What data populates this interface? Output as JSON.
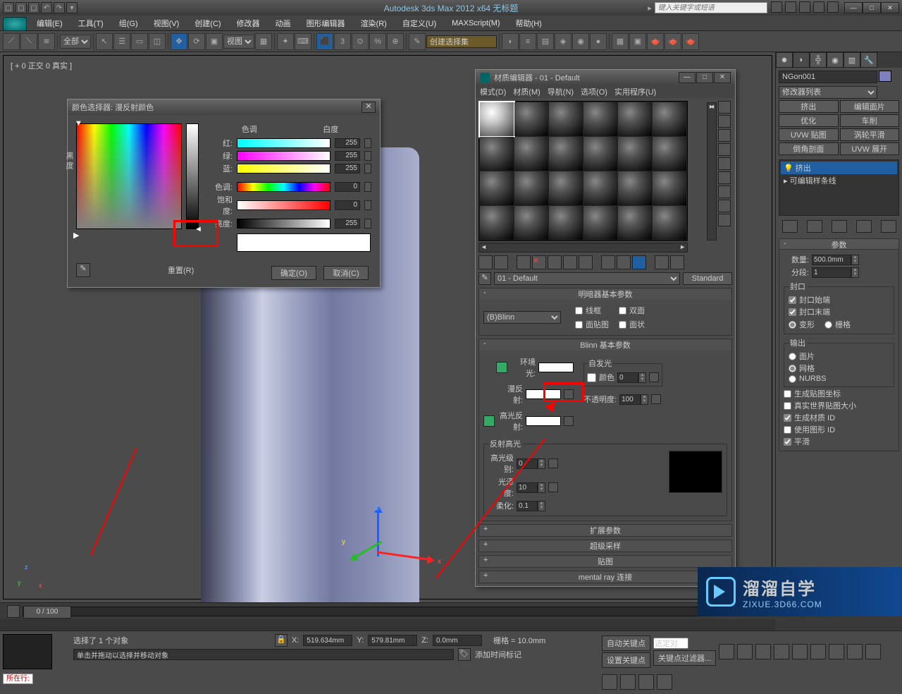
{
  "title": "Autodesk 3ds Max 2012 x64   无标题",
  "searchPlaceholder": "键入关键字或短语",
  "menubar": [
    "编辑(E)",
    "工具(T)",
    "组(G)",
    "视图(V)",
    "创建(C)",
    "修改器",
    "动画",
    "图形编辑器",
    "渲染(R)",
    "自定义(U)",
    "MAXScript(M)",
    "帮助(H)"
  ],
  "toolbar": {
    "selFilter": "全部",
    "refCoord": "视图",
    "namedSel": "创建选择集"
  },
  "viewport": {
    "label": "[ + 0 正交 0 真实 ]"
  },
  "gizmo": {
    "x": "x",
    "y": "y",
    "z": "z"
  },
  "cmd": {
    "objName": "NGon001",
    "modList": "修改器列表",
    "btns": [
      [
        "挤出",
        "编辑面片"
      ],
      [
        "优化",
        "车削"
      ],
      [
        "UVW 贴图",
        "涡轮平滑"
      ],
      [
        "倒角剖面",
        "UVW 展开"
      ]
    ],
    "stack": [
      "挤出",
      "可编辑样条线"
    ],
    "rollups": {
      "params": "参数",
      "amount": "数量:",
      "amountV": "500.0mm",
      "segs": "分段:",
      "segsV": "1",
      "cap": "封口",
      "capStart": "封口始端",
      "capEnd": "封口末端",
      "morph": "变形",
      "grid": "栅格",
      "output": "输出",
      "patch": "面片",
      "mesh": "网格",
      "nurbs": "NURBS",
      "genMapping": "生成贴图坐标",
      "realWorld": "真实世界贴图大小",
      "genMatID": "生成材质 ID",
      "useShapeID": "使用图形 ID",
      "smooth": "平滑"
    }
  },
  "time": {
    "frame": "0 / 100"
  },
  "status": {
    "goto": "所在行:",
    "selected": "选择了 1 个对象",
    "x": "X:",
    "xv": "519.634mm",
    "y": "Y:",
    "yv": "579.81mm",
    "z": "Z:",
    "zv": "0.0mm",
    "grid": "栅格 = 10.0mm",
    "hint": "单击并拖动以选择并移动对象",
    "addTime": "添加时间标记",
    "autoKey": "自动关键点",
    "setKey": "设置关键点",
    "keyFilter": "关键点过滤器...",
    "selOnly": "选定对"
  },
  "colorDlg": {
    "title": "颜色选择器: 漫反射颜色",
    "hue": "色调",
    "white": "白度",
    "black": "黑\n度",
    "r": "红:",
    "g": "绿:",
    "b": "蓝:",
    "h": "色调:",
    "s": "饱和度:",
    "v": "亮度:",
    "rv": "255",
    "gv": "255",
    "bv": "255",
    "hv": "0",
    "sv": "0",
    "vv": "255",
    "reset": "重置(R)",
    "ok": "确定(O)",
    "cancel": "取消(C)"
  },
  "matDlg": {
    "title": "材质编辑器 - 01 - Default",
    "menu": [
      "模式(D)",
      "材质(M)",
      "导航(N)",
      "选项(O)",
      "实用程序(U)"
    ],
    "name": "01 - Default",
    "type": "Standard",
    "shaderHdr": "明暗器基本参数",
    "shader": "(B)Blinn",
    "wire": "线框",
    "twoSide": "双面",
    "faceMap": "面贴图",
    "faceted": "面状",
    "blinnHdr": "Blinn 基本参数",
    "ambient": "环境光:",
    "diffuse": "漫反射:",
    "specular": "高光反射:",
    "selfIllum": "自发光",
    "color": "颜色",
    "colorV": "0",
    "opacity": "不透明度:",
    "opacityV": "100",
    "reflHdr": "反射高光",
    "specLevel": "高光级别:",
    "specLevelV": "0",
    "gloss": "光泽度:",
    "glossV": "10",
    "soften": "柔化:",
    "softenV": "0.1",
    "ext": "扩展参数",
    "super": "超级采样",
    "maps": "贴图",
    "mray": "mental ray 连接"
  },
  "watermark": {
    "cn": "溜溜自学",
    "url": "ZIXUE.3D66.COM"
  }
}
